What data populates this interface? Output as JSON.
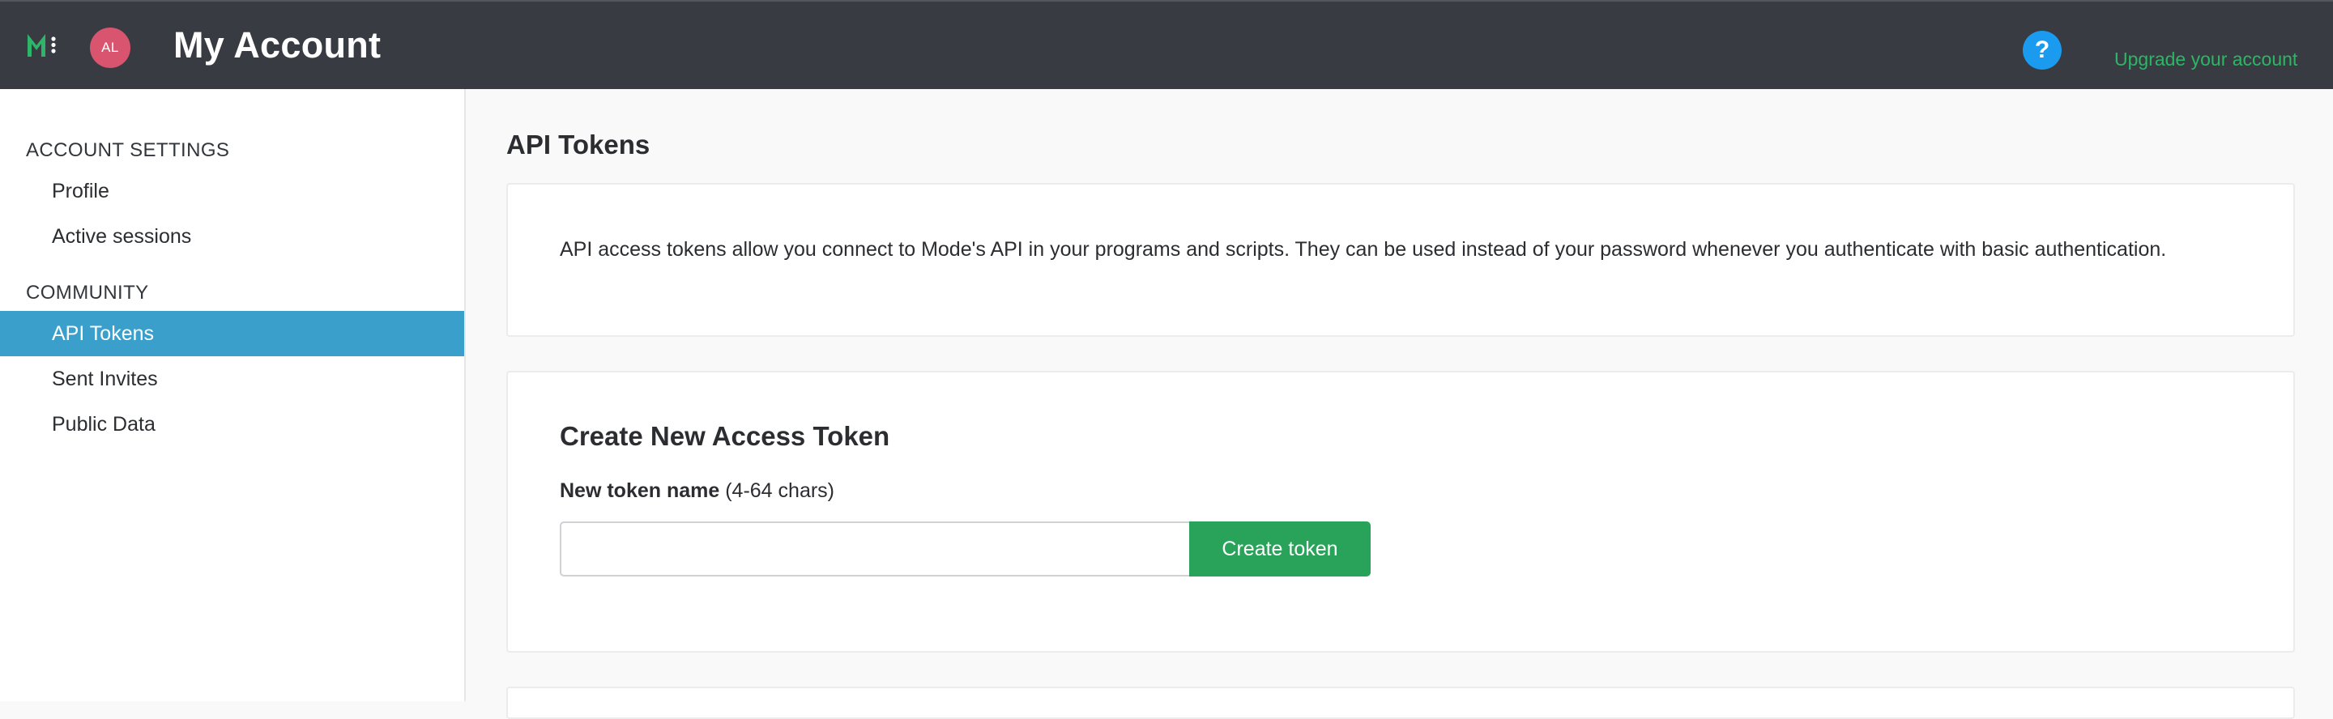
{
  "header": {
    "avatar_initials": "AL",
    "title": "My Account",
    "help_label": "?",
    "upgrade_link": "Upgrade your account",
    "logo_icon": "mode-logo-icon"
  },
  "colors": {
    "header_bg": "#393b42",
    "active_nav_bg": "#3a9fcb",
    "accent_green": "#29a35a",
    "link_green": "#2cb665",
    "help_blue": "#1a9bf0",
    "avatar_pink": "#d9546f"
  },
  "sidebar": {
    "sections": [
      {
        "heading": "ACCOUNT SETTINGS",
        "items": [
          {
            "label": "Profile"
          },
          {
            "label": "Active sessions"
          }
        ]
      },
      {
        "heading": "COMMUNITY",
        "items": [
          {
            "label": "API Tokens",
            "active": true
          },
          {
            "label": "Sent Invites"
          },
          {
            "label": "Public Data"
          }
        ]
      }
    ]
  },
  "main": {
    "title": "API Tokens",
    "description": "API access tokens allow you connect to Mode's API in your programs and scripts. They can be used instead of your password whenever you authenticate with basic authentication.",
    "create_card": {
      "title": "Create New Access Token",
      "field_label_bold": "New token name",
      "field_label_hint": " (4-64 chars)",
      "input_value": "",
      "input_placeholder": "",
      "button_label": "Create token"
    }
  }
}
